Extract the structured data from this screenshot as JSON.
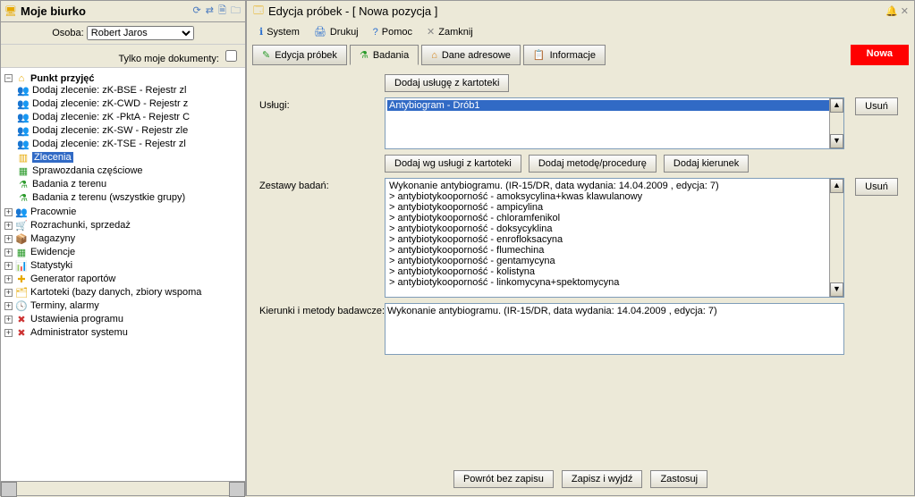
{
  "left": {
    "title": "Moje biurko",
    "toolbar_icons": [
      "refresh",
      "link",
      "new-doc",
      "folder"
    ],
    "person_label": "Osoba:",
    "person_value": "Robert Jaros",
    "filter_label": "Tylko moje dokumenty:",
    "tree": {
      "root": "Punkt przyjęć",
      "orders": [
        "Dodaj zlecenie: zK-BSE - Rejestr zl",
        "Dodaj zlecenie: zK-CWD - Rejestr z",
        "Dodaj zlecenie: zK -PktA - Rejestr C",
        "Dodaj zlecenie: zK-SW - Rejestr zle",
        "Dodaj zlecenie: zK-TSE - Rejestr zl"
      ],
      "zlecenia": "Zlecenia",
      "after_zlecenia": [
        "Sprawozdania częściowe",
        "Badania z terenu",
        "Badania z terenu (wszystkie grupy)"
      ],
      "rest": [
        "Pracownie",
        "Rozrachunki, sprzedaż",
        "Magazyny",
        "Ewidencje",
        "Statystyki",
        "Generator raportów",
        "Kartoteki (bazy danych, zbiory wspoma",
        "Terminy, alarmy",
        "Ustawienia programu",
        "Administrator systemu"
      ]
    }
  },
  "right": {
    "title": "Edycja próbek - [ Nowa pozycja ]",
    "menu": [
      "System",
      "Drukuj",
      "Pomoc",
      "Zamknij"
    ],
    "tabs": [
      "Edycja próbek",
      "Badania",
      "Dane adresowe",
      "Informacje"
    ],
    "active_tab": 1,
    "nowa": "Nowa",
    "uslugi_label": "Usługi:",
    "dodaj_usluge": "Dodaj usługę z kartoteki",
    "usun": "Usuń",
    "uslugi_items": [
      "Antybiogram - Drób1"
    ],
    "zestawy_label": "Zestawy badań:",
    "zestawy_buttons": [
      "Dodaj wg usługi z kartoteki",
      "Dodaj metodę/procedurę",
      "Dodaj kierunek"
    ],
    "zestawy_items": [
      "Wykonanie antybiogramu. (IR-15/DR, data wydania: 14.04.2009 , edycja: 7)",
      " > antybiotykooporność - amoksycylina+kwas klawulanowy",
      " > antybiotykooporność - ampicylina",
      " > antybiotykooporność - chloramfenikol",
      " > antybiotykooporność - doksycyklina",
      " > antybiotykooporność - enrofloksacyna",
      " > antybiotykooporność - flumechina",
      " > antybiotykooporność - gentamycyna",
      " > antybiotykooporność - kolistyna",
      " > antybiotykooporność - linkomycyna+spektomycyna"
    ],
    "kierunki_label": "Kierunki i metody badawcze:",
    "kierunki_value": "Wykonanie antybiogramu. (IR-15/DR, data wydania: 14.04.2009 , edycja: 7)",
    "footer_buttons": [
      "Powrót bez zapisu",
      "Zapisz i wyjdź",
      "Zastosuj"
    ]
  }
}
